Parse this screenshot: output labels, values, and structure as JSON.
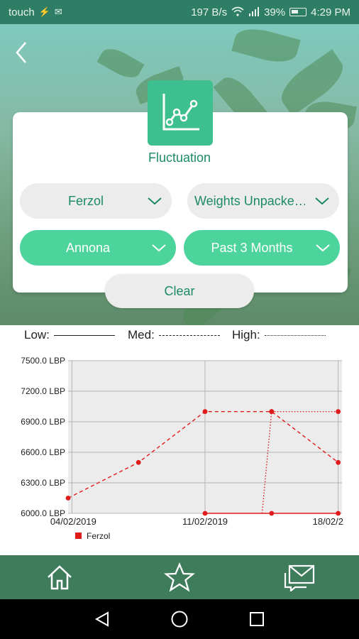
{
  "status_bar": {
    "carrier": "touch",
    "speed": "197 B/s",
    "battery": "39%",
    "time": "4:29 PM",
    "icons": [
      "usb-icon",
      "mail-icon",
      "wifi-icon",
      "signal-icon",
      "battery-icon"
    ]
  },
  "header": {
    "back_icon": "chevron-left-icon"
  },
  "card": {
    "title": "Fluctuation",
    "logo_icon": "line-chart-icon",
    "filters": {
      "product": "Ferzol",
      "package": "Weights Unpacke…",
      "crop": "Annona",
      "period": "Past 3 Months"
    },
    "clear_label": "Clear"
  },
  "legend_bar": {
    "low": "Low:",
    "med": "Med:",
    "high": "High:"
  },
  "colors": {
    "accent": "#4dd49c",
    "brand_dark": "#1d8a68",
    "series": "#e01b1b",
    "nav": "#3f7c5c"
  },
  "chart_data": {
    "type": "line",
    "title": "",
    "xlabel": "",
    "ylabel": "",
    "y_tick_labels": [
      "7500.0 LBP",
      "7200.0 LBP",
      "6900.0 LBP",
      "6600.0 LBP",
      "6300.0 LBP",
      "6000.0 LBP"
    ],
    "y_ticks": [
      7500,
      7200,
      6900,
      6600,
      6300,
      6000
    ],
    "ylim": [
      6000,
      7500
    ],
    "x_tick_labels": [
      "04/02/2019",
      "11/02/2019",
      "18/02/2"
    ],
    "x_ticks": [
      0,
      7,
      14
    ],
    "xlim": [
      -0.2,
      14.2
    ],
    "grid": true,
    "legend": {
      "placement": "bottom-left",
      "entries": [
        "Ferzol"
      ]
    },
    "series": [
      {
        "name": "Ferzol",
        "style": "med",
        "x": [
          -0.2,
          3.5,
          7,
          10.5,
          14
        ],
        "y": [
          6150,
          6500,
          7000,
          7000,
          6500
        ]
      },
      {
        "name": "Ferzol",
        "style": "low",
        "x": [
          7,
          10.5,
          14
        ],
        "y": [
          6000,
          6000,
          6000
        ]
      },
      {
        "name": "Ferzol",
        "style": "high",
        "x": [
          10,
          10.5,
          14
        ],
        "y": [
          6000,
          7000,
          7000
        ]
      }
    ]
  },
  "bottom_nav": {
    "items": [
      "home-icon",
      "star-icon",
      "messages-icon"
    ]
  },
  "system_nav": {
    "items": [
      "back-icon",
      "home-circle-icon",
      "recents-icon"
    ]
  }
}
